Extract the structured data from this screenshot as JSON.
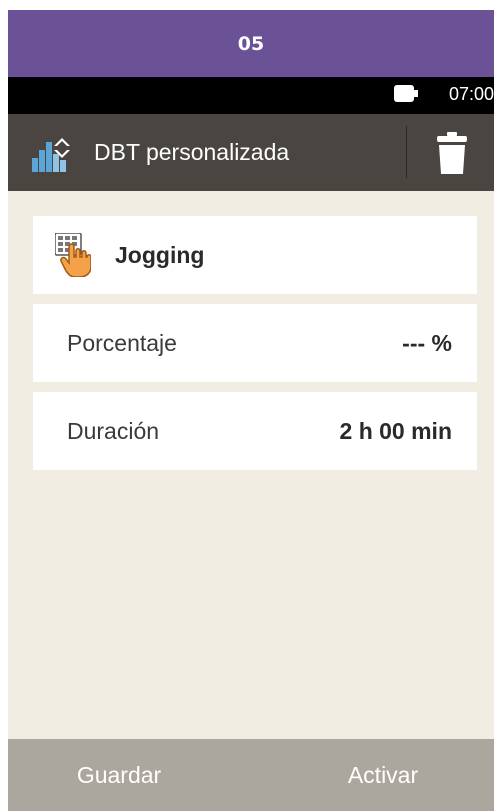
{
  "step": {
    "number": "05",
    "color": "#6b5196"
  },
  "status_bar": {
    "time": "07:00",
    "battery_icon": "battery-icon"
  },
  "header": {
    "icon": "basal-profile-icon",
    "title": "DBT personalizada",
    "delete_icon": "trash-icon"
  },
  "settings": {
    "program": {
      "icon": "hand-keypad-icon",
      "name": "Jogging"
    },
    "percent": {
      "label": "Porcentaje",
      "value": "--- %"
    },
    "duration": {
      "label": "Duración",
      "value": "2 h 00 min"
    }
  },
  "soft_keys": {
    "left": "Guardar",
    "right": "Activar"
  },
  "colors": {
    "background": "#f1ede2",
    "title_bar": "#4a4541",
    "bottom_bar": "#aba79e",
    "row": "#ffffff"
  }
}
